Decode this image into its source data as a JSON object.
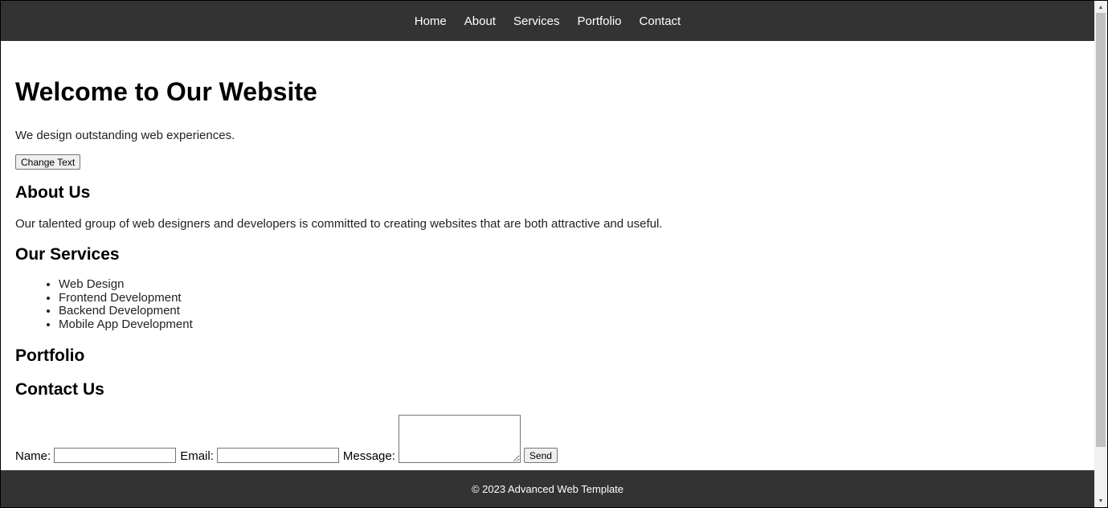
{
  "nav": {
    "items": [
      "Home",
      "About",
      "Services",
      "Portfolio",
      "Contact"
    ]
  },
  "hero": {
    "title": "Welcome to Our Website",
    "tagline": "We design outstanding web experiences.",
    "button_label": "Change Text"
  },
  "about": {
    "title": "About Us",
    "text": "Our talented group of web designers and developers is committed to creating websites that are both attractive and useful."
  },
  "services": {
    "title": "Our Services",
    "items": [
      "Web Design",
      "Frontend Development",
      "Backend Development",
      "Mobile App Development"
    ]
  },
  "portfolio": {
    "title": "Portfolio"
  },
  "contact": {
    "title": "Contact Us",
    "name_label": "Name:",
    "email_label": "Email:",
    "message_label": "Message:",
    "name_value": "",
    "email_value": "",
    "send_label": "Send"
  },
  "footer": {
    "text": "© 2023 Advanced Web Template"
  },
  "colors": {
    "nav_bg": "#333333",
    "footer_bg": "#333333",
    "nav_text": "#ffffff"
  },
  "scrollbar": {
    "up_icon": "scroll-up-arrow-icon",
    "down_icon": "scroll-down-arrow-icon"
  }
}
